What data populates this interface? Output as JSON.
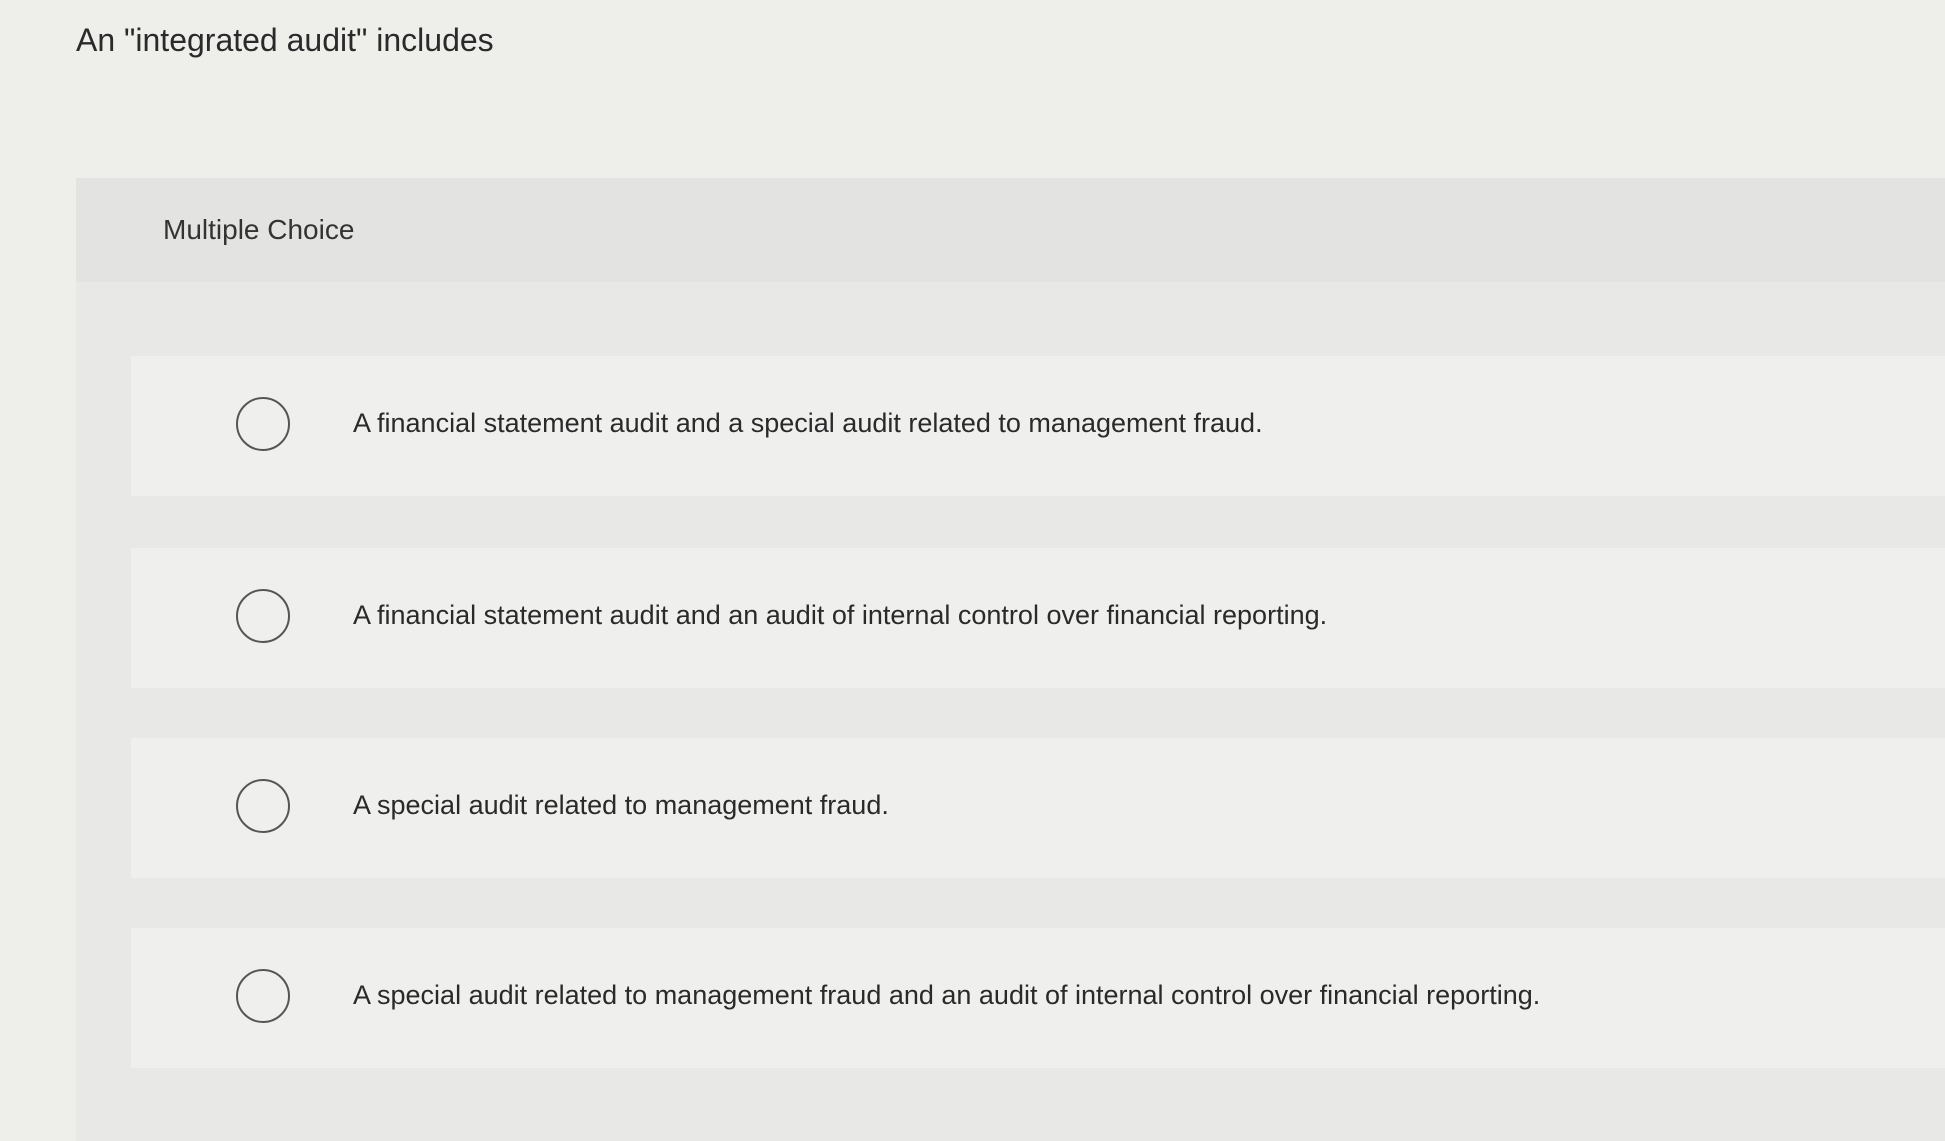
{
  "question": {
    "text": "An \"integrated audit\" includes"
  },
  "multiple_choice": {
    "label": "Multiple Choice",
    "options": [
      {
        "text": "A financial statement audit and a special audit related to management fraud.",
        "selected": false
      },
      {
        "text": "A financial statement audit and an audit of internal control over financial reporting.",
        "selected": false
      },
      {
        "text": "A special audit related to management fraud.",
        "selected": false
      },
      {
        "text": "A special audit related to management fraud and an audit of internal control over financial reporting.",
        "selected": false
      }
    ]
  }
}
